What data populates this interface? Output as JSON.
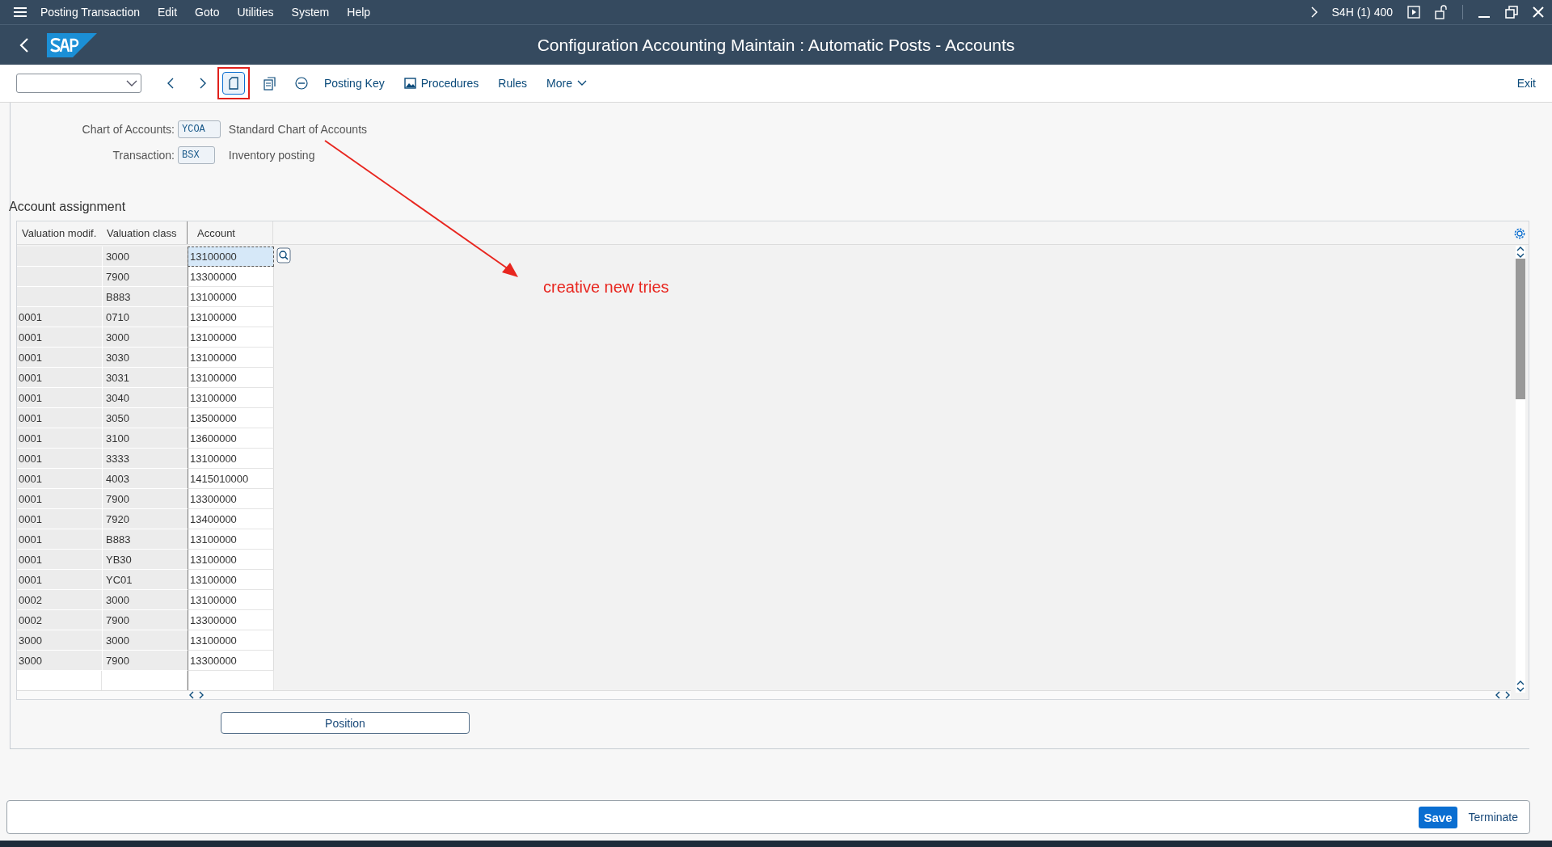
{
  "menu_bar": {
    "items": [
      "Posting Transaction",
      "Edit",
      "Goto",
      "Utilities",
      "System",
      "Help"
    ],
    "system": "S4H (1) 400"
  },
  "title_bar": {
    "title": "Configuration Accounting Maintain : Automatic Posts - Accounts"
  },
  "toolbar": {
    "buttons": [
      {
        "kind": "text",
        "label": "Posting Key"
      },
      {
        "kind": "icon-text",
        "label": "Procedures"
      },
      {
        "kind": "text",
        "label": "Rules"
      },
      {
        "kind": "menu",
        "label": "More"
      }
    ],
    "exit": "Exit"
  },
  "header_fields": [
    {
      "label": "Chart of Accounts:",
      "value": "YCOA",
      "description": "Standard Chart of Accounts"
    },
    {
      "label": "Transaction:",
      "value": "BSX",
      "description": "Inventory posting"
    }
  ],
  "table": {
    "title": "Account assignment",
    "columns": [
      "Valuation modif.",
      "Valuation class",
      "Account"
    ],
    "rows": [
      {
        "valuation_class": "3000",
        "account": "13100000",
        "selected": true
      },
      {
        "valuation_class": "7900",
        "account": "13300000",
        "selected": false
      },
      {
        "valuation_class": "B883",
        "account": "13100000",
        "selected": false
      },
      {
        "valuation_modif": "0001",
        "valuation_class": "0710",
        "account": "13100000",
        "selected": false
      },
      {
        "valuation_modif": "0001",
        "valuation_class": "3000",
        "account": "13100000",
        "selected": false
      },
      {
        "valuation_modif": "0001",
        "valuation_class": "3030",
        "account": "13100000",
        "selected": false
      },
      {
        "valuation_modif": "0001",
        "valuation_class": "3031",
        "account": "13100000",
        "selected": false
      },
      {
        "valuation_modif": "0001",
        "valuation_class": "3040",
        "account": "13100000",
        "selected": false
      },
      {
        "valuation_modif": "0001",
        "valuation_class": "3050",
        "account": "13500000",
        "selected": false
      },
      {
        "valuation_modif": "0001",
        "valuation_class": "3100",
        "account": "13600000",
        "selected": false
      },
      {
        "valuation_modif": "0001",
        "valuation_class": "3333",
        "account": "13100000",
        "selected": false
      },
      {
        "valuation_modif": "0001",
        "valuation_class": "4003",
        "account": "1415010000",
        "selected": false
      },
      {
        "valuation_modif": "0001",
        "valuation_class": "7900",
        "account": "13300000",
        "selected": false
      },
      {
        "valuation_modif": "0001",
        "valuation_class": "7920",
        "account": "13400000",
        "selected": false
      },
      {
        "valuation_modif": "0001",
        "valuation_class": "B883",
        "account": "13100000",
        "selected": false
      },
      {
        "valuation_modif": "0001",
        "valuation_class": "YB30",
        "account": "13100000",
        "selected": false
      },
      {
        "valuation_modif": "0001",
        "valuation_class": "YC01",
        "account": "13100000",
        "selected": false
      },
      {
        "valuation_modif": "0002",
        "valuation_class": "3000",
        "account": "13100000",
        "selected": false
      },
      {
        "valuation_modif": "0002",
        "valuation_class": "7900",
        "account": "13300000",
        "selected": false
      },
      {
        "valuation_modif": "3000",
        "valuation_class": "3000",
        "account": "13100000",
        "selected": false
      },
      {
        "valuation_modif": "3000",
        "valuation_class": "7900",
        "account": "13300000",
        "selected": false
      }
    ]
  },
  "position_button": "Position",
  "annotation": {
    "text": "creative new tries"
  },
  "footer": {
    "buttons": [
      {
        "kind": "primary",
        "label": "Save"
      },
      {
        "kind": "text",
        "label": "Terminate"
      }
    ]
  }
}
